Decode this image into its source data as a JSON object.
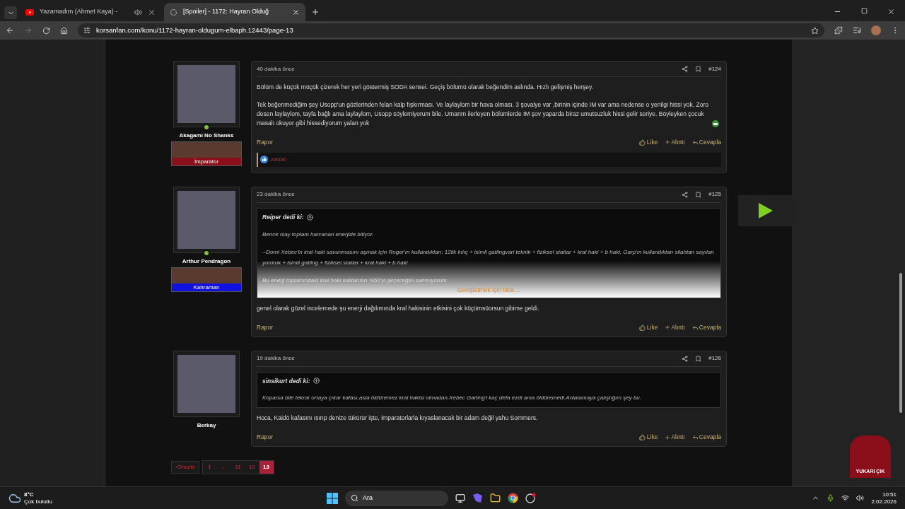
{
  "browser": {
    "tabs": [
      {
        "kind": "video",
        "title": "Yazamadım (Ahmet Kaya) -",
        "audio": true,
        "selected": false
      },
      {
        "kind": "forum",
        "title": "[Spoiler] - 1172: Hayran Olduğ",
        "audio": false,
        "selected": true
      }
    ],
    "url": "korsanfan.com/konu/1172-hayran-oldugum-elbaph.12443/page-13"
  },
  "posts": [
    {
      "user": {
        "name": "Akagami No Shanks",
        "online": true,
        "rank": {
          "title": "İmparator",
          "color": "#8b0f1a"
        }
      },
      "time": "40 dakika önce",
      "number": "#124",
      "paragraphs": [
        "Bölüm de küçük müçük çizerek her yeri göstermiş SODA sensei. Geçiş bölümü olarak beğendim aslında. Hızlı gelişmiş herşey.",
        "Tek beğenmediğim şey Usopp'un gözlerinden felan kalp fışkırması. Ve laylaylom bir hava olması. 3 şovalye var ,birinin içinde IM var ama nedense o yenilgi hissi yok. Zoro desen laylaylom, tayfa bağlı ama laylaylom, Usopp söylemiyorum bile. Umarım ilerleyen bölümlerde IM şov yaparda biraz umutsuzluk hissi gelir seriye. Böyleyken çocuk masalı okuyor gibi hissediyorum yalan yok"
      ],
      "emoji": true,
      "report": "Rapor",
      "like": "Like",
      "quote_action": "Alıntı",
      "reply": "Cevapla",
      "reactions": "Jotloki"
    },
    {
      "user": {
        "name": "Arthur Pendragon",
        "online": true,
        "rank": {
          "title": "Kahraman",
          "color": "#1010e0"
        }
      },
      "time": "23 dakika önce",
      "number": "#125",
      "quote": {
        "author": "Reiper dedi ki:",
        "collapsed": true,
        "expand": "Genişletmek için tıkla ...",
        "paragraphs": [
          "Bence olay toplam harcanan enerjide bitiyor.",
          "--Domi Xebec'in kral haki savunmasını aşmak için Roger'ın kullandıkları; 12lik kılıç + isimli gatlingvari teknik + fiziksel statlar + kral haki + b haki, Garp'ın kullandıkları silahtan sayılan yumruk + isimli gatling + fiziksel statlar + kral haki + b haki",
          "Bu enerji toplamındaki kral haki miktarının %50'yi geçeceğini sanmıyorum."
        ]
      },
      "paragraphs": [
        "genel olarak güzel incelemede şu enerji dağılımında kral hakisinin etkisini çok küçümsüorsun gibime geldi."
      ],
      "emoji": false,
      "report": "Rapor",
      "like": "Like",
      "quote_action": "Alıntı",
      "reply": "Cevapla"
    },
    {
      "user": {
        "name": "Berkay",
        "online": false
      },
      "time": "19 dakika önce",
      "number": "#126",
      "quote": {
        "author": "sinsikurt dedi ki:",
        "collapsed": false,
        "paragraphs": [
          "Koparsa bile tekrar ortaya çıkar kafası,asla öldüremez kral hakisi olmadan.Xebec Garling'i kaç defa ezdi ama öldüremedi.Anlatamaya çalıştığım şey bu."
        ]
      },
      "paragraphs": [
        "Hoca, Kaidō kafasını ısırıp denize tükürür işte, imparatorlarla kıyaslanacak bir adam değil yahu Sommers."
      ],
      "emoji": false,
      "report": "Rapor",
      "like": "Like",
      "quote_action": "Alıntı",
      "reply": "Cevapla"
    }
  ],
  "pagination": {
    "previous": "‹Önceki",
    "pages": [
      {
        "label": "1",
        "selected": false
      },
      {
        "label": "...",
        "selected": false
      },
      {
        "label": "11",
        "selected": false
      },
      {
        "label": "12",
        "selected": false
      },
      {
        "label": "13",
        "selected": true
      }
    ]
  },
  "scroll_top": "YUKARI ÇIK",
  "taskbar": {
    "temperature": "8°C",
    "weather": "Çok bulutlu",
    "search": "Ara",
    "time": "10:51",
    "date": "2.02.2026"
  }
}
